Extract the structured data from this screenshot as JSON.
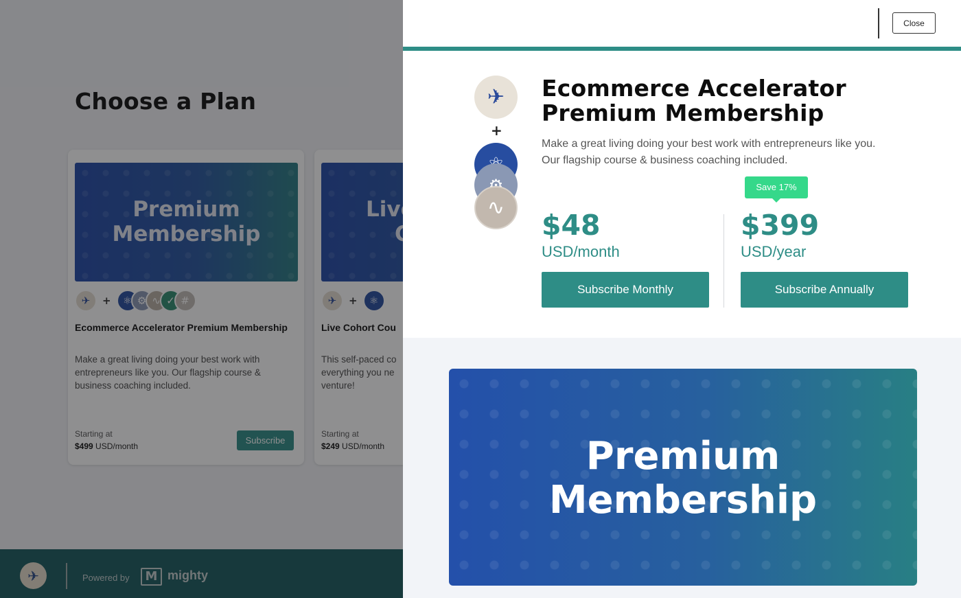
{
  "page": {
    "title": "Choose a Plan"
  },
  "cards": [
    {
      "banner_line1": "Premium",
      "banner_line2": "Membership",
      "name": "Ecommerce Accelerator Premium Membership",
      "description": "Make a great living doing your best work with entrepreneurs like you. Our flagship course & business coaching included.",
      "starting_label": "Starting at",
      "price_bold": "$499",
      "price_unit": " USD/month",
      "subscribe_label": "Subscribe",
      "icons": [
        "brand-logo-icon",
        "atom-icon",
        "gear-icon",
        "wave-icon",
        "check-icon",
        "hash-icon"
      ]
    },
    {
      "banner_line1": "Live",
      "banner_line2": "C",
      "name": "Live Cohort Cou",
      "description": "This self-paced co everything you ne venture!",
      "starting_label": "Starting at",
      "price_bold": "$249",
      "price_unit": " USD/month",
      "icons": [
        "brand-logo-icon",
        "atom-icon"
      ]
    }
  ],
  "footer": {
    "powered_by": "Powered by",
    "brand": "mighty",
    "brand_mark": "M"
  },
  "drawer": {
    "close_label": "Close",
    "plan_title_line1": "Ecommerce Accelerator",
    "plan_title_line2": "Premium Membership",
    "plus": "+",
    "description": "Make a great living doing your best work with entrepreneurs like you. Our flagship course & business coaching included.",
    "save_badge": "Save 17%",
    "monthly": {
      "price": "$48",
      "unit": "USD/month",
      "button": "Subscribe Monthly"
    },
    "yearly": {
      "price": "$399",
      "unit": "USD/year",
      "button": "Subscribe Annually"
    },
    "hero_line1": "Premium",
    "hero_line2": "Membership"
  },
  "colors": {
    "accent": "#2e8d86",
    "save_badge": "#35d88a",
    "footer": "#1a5a5e",
    "banner_blue": "#2450aa"
  }
}
